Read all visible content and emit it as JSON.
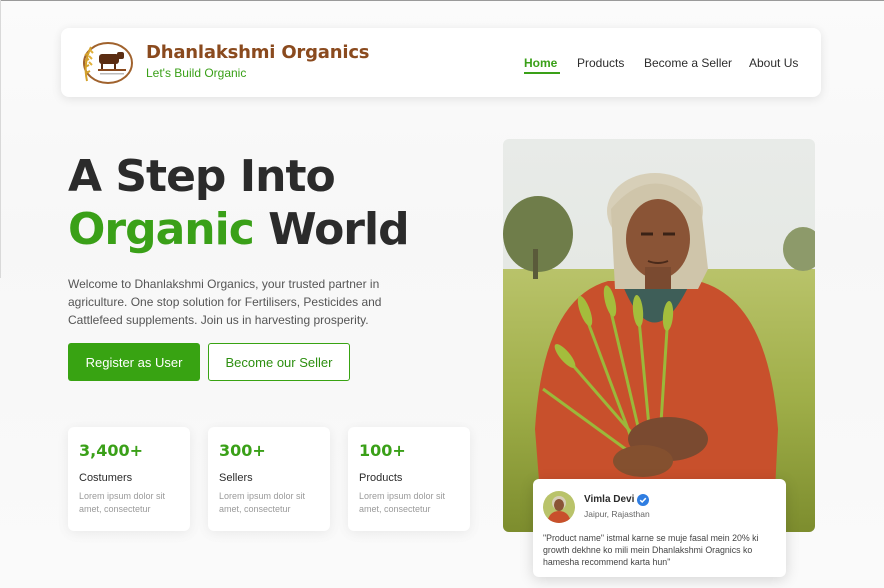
{
  "brand": {
    "name": "Dhanlakshmi Organics",
    "tagline": "Let's Build Organic",
    "logo_icon": "cow-wheat-logo"
  },
  "nav": {
    "items": [
      {
        "label": "Home",
        "active": true
      },
      {
        "label": "Products",
        "active": false
      },
      {
        "label": "Become a Seller",
        "active": false
      },
      {
        "label": "About Us",
        "active": false
      }
    ]
  },
  "hero": {
    "title_line1": "A Step Into",
    "title_green": "Organic",
    "title_rest": " World",
    "description": "Welcome to Dhanlakshmi Organics, your trusted partner in agriculture. One stop solution for Fertilisers, Pesticides and Cattlefeed supplements. Join us in harvesting prosperity.",
    "primary_button": "Register as User",
    "secondary_button": "Become our Seller"
  },
  "stats": [
    {
      "value": "3,400+",
      "label": "Costumers",
      "text": "Lorem ipsum dolor sit amet, consectetur"
    },
    {
      "value": "300+",
      "label": "Sellers",
      "text": "Lorem ipsum dolor sit amet, consectetur"
    },
    {
      "value": "100+",
      "label": "Products",
      "text": "Lorem ipsum dolor sit amet, consectetur"
    }
  ],
  "testimonial": {
    "name": "Vimla Devi",
    "location": "Jaipur, Rajasthan",
    "quote": "\"Product name\" istmal karne se muje fasal mein 20% ki growth dekhne ko mili mein Dhanlakshmi Oragnics ko hamesha recommend karta hun\""
  },
  "colors": {
    "accent": "#3aa018",
    "brand_brown": "#8a4a1e"
  }
}
